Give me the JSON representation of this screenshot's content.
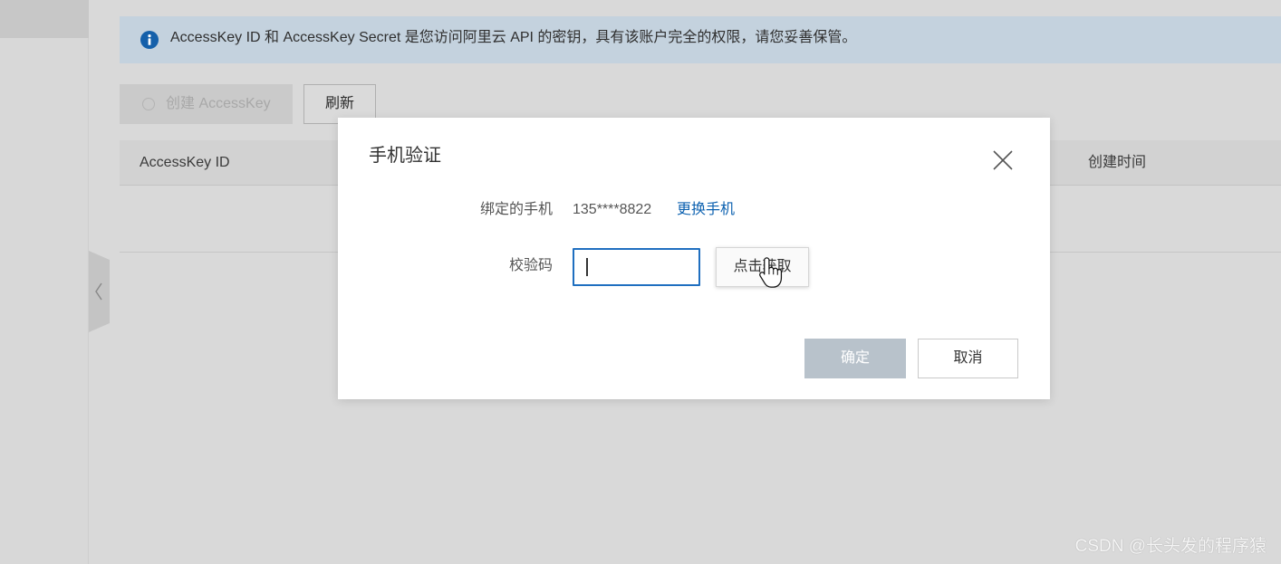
{
  "colors": {
    "accent": "#0c61b0",
    "input_focus_border": "#1f6fc0",
    "confirm_disabled_bg": "#b8c2cb",
    "banner_bg": "#c4d2de",
    "info_icon": "#1560aa"
  },
  "sidebar": {
    "collapse_icon": "chevron-left-icon"
  },
  "banner": {
    "icon": "info-icon",
    "text": "AccessKey ID 和 AccessKey Secret 是您访问阿里云 API 的密钥，具有该账户完全的权限，请您妥善保管。"
  },
  "toolbar": {
    "create_icon": "spinner-icon",
    "create_label": "创建 AccessKey",
    "create_disabled": true,
    "refresh_label": "刷新"
  },
  "table": {
    "columns": [
      "AccessKey ID",
      "创建时间"
    ]
  },
  "modal": {
    "title": "手机验证",
    "close_icon": "close-icon",
    "phone_label": "绑定的手机",
    "phone_value": "135****8822",
    "change_phone_link": "更换手机",
    "code_label": "校验码",
    "get_code_button": "点击获取",
    "confirm_label": "确定",
    "confirm_disabled": true,
    "cancel_label": "取消"
  },
  "cursor": {
    "icon": "hand-cursor-icon"
  },
  "watermark": "CSDN @长头发的程序猿"
}
